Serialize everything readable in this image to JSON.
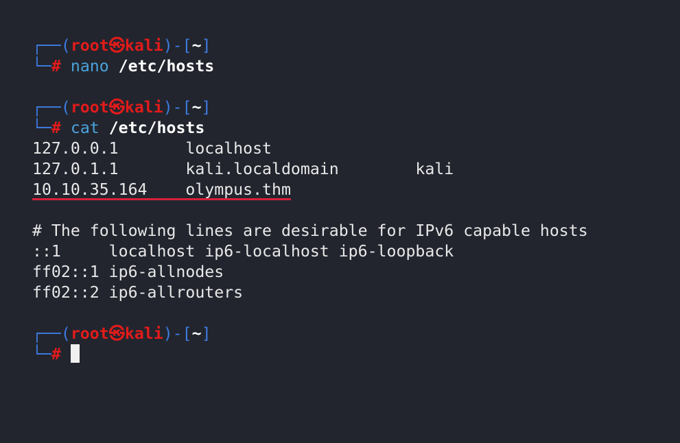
{
  "prompt": {
    "user": "root",
    "host": "kali",
    "sep": "㉿",
    "dir": "~",
    "symbol": "#"
  },
  "commands": [
    {
      "cmd": "nano",
      "arg": "/etc/hosts"
    },
    {
      "cmd": "cat",
      "arg": "/etc/hosts"
    }
  ],
  "output": [
    "127.0.0.1       localhost",
    "127.0.1.1       kali.localdomain        kali",
    "10.10.35.164    olympus.thm",
    "",
    "# The following lines are desirable for IPv6 capable hosts",
    "::1     localhost ip6-localhost ip6-loopback",
    "ff02::1 ip6-allnodes",
    "ff02::2 ip6-allrouters"
  ],
  "colors": {
    "background": "#22252e",
    "prompt_frame": "#3d7be0",
    "prompt_user": "#e21b1b",
    "command": "#4aa3dc",
    "highlight_underline": "#d8203a"
  }
}
